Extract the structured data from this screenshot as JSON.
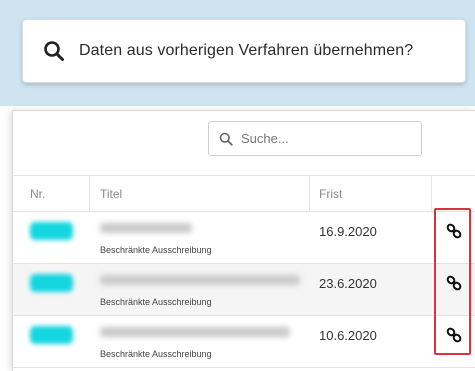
{
  "banner": {
    "text": "Daten aus vorherigen Verfahren übernehmen?",
    "icon": "search-icon"
  },
  "search": {
    "placeholder": "Suche...",
    "icon": "search-icon"
  },
  "table": {
    "columns": {
      "nr": "Nr.",
      "titel": "Titel",
      "frist": "Frist"
    },
    "rows": [
      {
        "subtitle": "Beschränkte Ausschreibung",
        "frist": "16.9.2020",
        "action_icon": "link-icon"
      },
      {
        "subtitle": "Beschränkte Ausschreibung",
        "frist": "23.6.2020",
        "action_icon": "link-icon"
      },
      {
        "subtitle": "Beschränkte Ausschreibung",
        "frist": "10.6.2020",
        "action_icon": "link-icon"
      }
    ]
  },
  "colors": {
    "band": "#cfe4f1",
    "nr_chip": "#14d6e0",
    "highlight": "#d9333f"
  }
}
